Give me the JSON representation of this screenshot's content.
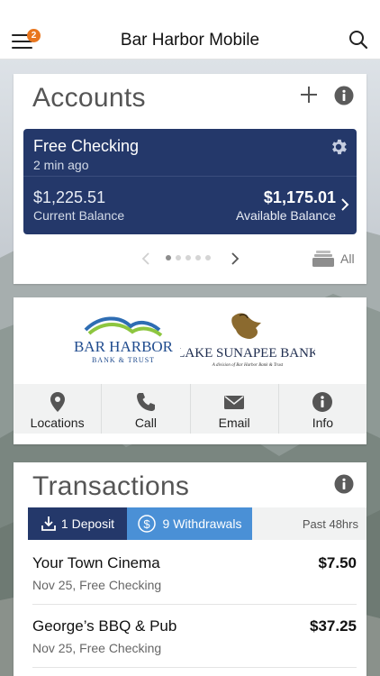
{
  "header": {
    "title": "Bar Harbor Mobile",
    "menu_badge_count": "2",
    "menu_icon": "hamburger-menu-icon",
    "search_icon": "search-icon",
    "badge_color": "#e8761e"
  },
  "accounts": {
    "title": "Accounts",
    "account": {
      "name": "Free Checking",
      "updated": "2 min ago",
      "current_balance": "$1,225.51",
      "current_label": "Current Balance",
      "available_balance": "$1,175.01",
      "available_label": "Available Balance",
      "tile_color": "#24386a"
    },
    "pager": {
      "total_pages": 5,
      "active_page": 1
    },
    "all_label": "All"
  },
  "bank": {
    "logos": [
      "Bar Harbor Bank & Trust",
      "Lake Sunapee Bank"
    ],
    "contacts": [
      {
        "label": "Locations",
        "icon": "map-pin-icon"
      },
      {
        "label": "Call",
        "icon": "phone-icon"
      },
      {
        "label": "Email",
        "icon": "envelope-icon"
      },
      {
        "label": "Info",
        "icon": "info-icon"
      }
    ]
  },
  "transactions": {
    "title": "Transactions",
    "deposit_tab": "1 Deposit",
    "withdrawal_tab": "9 Withdrawals",
    "period": "Past 48hrs",
    "items": [
      {
        "name": "Your Town Cinema",
        "amount": "$7.50",
        "detail": "Nov 25, Free Checking"
      },
      {
        "name": "George’s BBQ & Pub",
        "amount": "$37.25",
        "detail": "Nov 25, Free Checking"
      }
    ],
    "deposit_color": "#24386a",
    "withdraw_color": "#4a90d6"
  }
}
